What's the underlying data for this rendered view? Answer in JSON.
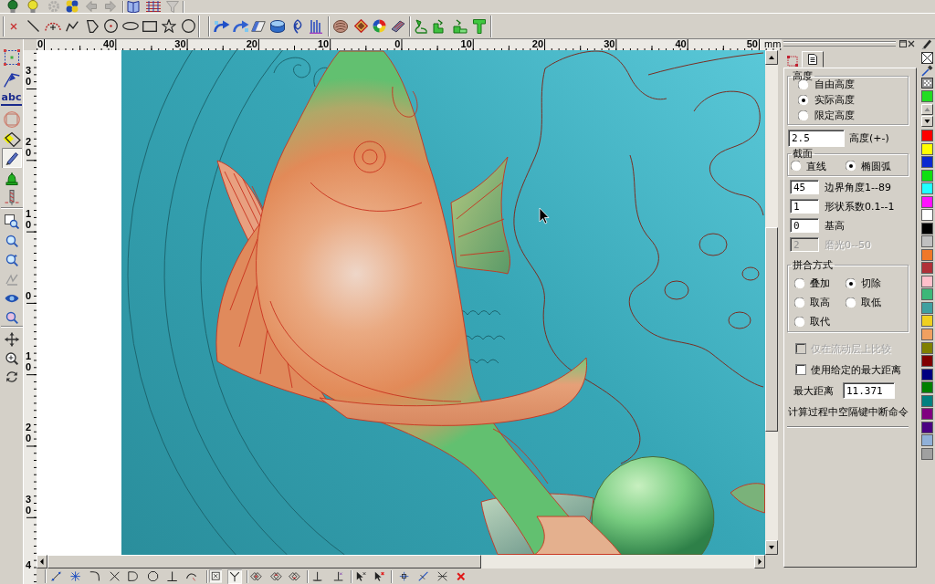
{
  "top_toolbar": [
    {
      "disabled": false
    },
    {
      "disabled": false
    },
    {
      "disabled": true
    },
    {
      "disabled": false
    },
    {
      "disabled": true
    },
    {
      "disabled": true
    },
    {
      "disabled": false
    },
    {
      "disabled": false
    },
    {
      "disabled": true
    }
  ],
  "left_toolbar": [
    {
      "pressed": false
    },
    {
      "pressed": false
    },
    {
      "label": "abc",
      "pressed": false
    },
    {
      "pressed": false
    },
    {
      "pressed": false
    },
    {
      "pressed": true
    },
    {
      "pressed": false
    },
    {
      "pressed": false
    },
    {
      "pressed": false
    },
    {
      "pressed": false
    },
    {
      "pressed": false
    },
    {
      "pressed": false
    },
    {
      "pressed": false
    },
    {
      "pressed": false
    },
    {
      "pressed": false
    },
    {
      "pressed": false
    },
    {
      "pressed": false
    }
  ],
  "horizontal_ruler": {
    "labels": [
      "0",
      "40",
      "30",
      "20",
      "10",
      "0",
      "10",
      "20",
      "30",
      "40",
      "50"
    ],
    "unit": "mm"
  },
  "vertical_ruler": {
    "labels": [
      "30",
      "20",
      "10",
      "0",
      "10",
      "20",
      "30",
      "4"
    ]
  },
  "bottom_toolbar": [
    {
      "pressed": false
    },
    {
      "pressed": false
    },
    {
      "pressed": false
    },
    {
      "pressed": false
    },
    {
      "pressed": false
    },
    {
      "pressed": false
    },
    {
      "pressed": false
    },
    {
      "pressed": false
    },
    {
      "pressed": true
    },
    {
      "pressed": true
    },
    {
      "pressed": false
    },
    {
      "pressed": false
    },
    {
      "pressed": false
    },
    {
      "pressed": false
    },
    {
      "pressed": false
    },
    {
      "pressed": false
    },
    {
      "pressed": false
    },
    {
      "pressed": false
    },
    {
      "pressed": false
    },
    {
      "pressed": false
    },
    {
      "pressed": false
    }
  ],
  "panel": {
    "tabs": [
      {
        "selected": false
      },
      {
        "selected": true
      }
    ],
    "height_group": {
      "title": "高度",
      "options": [
        {
          "label": "自由高度",
          "selected": false
        },
        {
          "label": "实际高度",
          "selected": true
        },
        {
          "label": "限定高度",
          "selected": false
        }
      ]
    },
    "height_field": {
      "value": "2.5",
      "label": "高度(+-)"
    },
    "section_group": {
      "title": "截面",
      "options": [
        {
          "label": "直线",
          "selected": false
        },
        {
          "label": "椭圆弧",
          "selected": true
        }
      ]
    },
    "fields": [
      {
        "value": "45",
        "label": "边界角度1--89",
        "disabled": false
      },
      {
        "value": "1",
        "label": "形状系数0.1--1",
        "disabled": false
      },
      {
        "value": "0",
        "label": "基高",
        "disabled": false
      },
      {
        "value": "2",
        "label": "磨光0--50",
        "disabled": true
      }
    ],
    "merge_group": {
      "title": "拼合方式",
      "options": [
        {
          "label": "叠加",
          "selected": false
        },
        {
          "label": "切除",
          "selected": true
        },
        {
          "label": "取高",
          "selected": false
        },
        {
          "label": "取低",
          "selected": false
        },
        {
          "label": "取代",
          "selected": false
        }
      ]
    },
    "checkboxes": [
      {
        "label": "仅在流动层上比较",
        "checked": false,
        "disabled": true
      },
      {
        "label": "使用给定的最大距离",
        "checked": false,
        "disabled": false
      }
    ],
    "max_distance": {
      "label": "最大距离",
      "value": "11.371"
    },
    "hint": "计算过程中空隔键中断命令"
  },
  "palette": {
    "current": {
      "color": "#22dd22"
    },
    "colors": [
      {
        "color": "#ff0000"
      },
      {
        "color": "#ffff00"
      },
      {
        "color": "#0a28d0"
      },
      {
        "color": "#10e010"
      },
      {
        "color": "#20ffff"
      },
      {
        "color": "#ff10ff"
      },
      {
        "color": "#ffffff"
      },
      {
        "color": "#000000"
      },
      {
        "color": "#c0c0c0"
      },
      {
        "color": "#f07828"
      },
      {
        "color": "#b03038"
      },
      {
        "color": "#ffc0cb"
      },
      {
        "color": "#3cb878"
      },
      {
        "color": "#40a0a0"
      },
      {
        "color": "#f0d020"
      },
      {
        "color": "#f0a060"
      },
      {
        "color": "#808000"
      },
      {
        "color": "#800000"
      },
      {
        "color": "#000080"
      },
      {
        "color": "#008000"
      },
      {
        "color": "#008080"
      },
      {
        "color": "#800080"
      },
      {
        "color": "#4b0082"
      },
      {
        "color": "#90b0d8"
      },
      {
        "color": "#a0a0a0"
      }
    ]
  }
}
